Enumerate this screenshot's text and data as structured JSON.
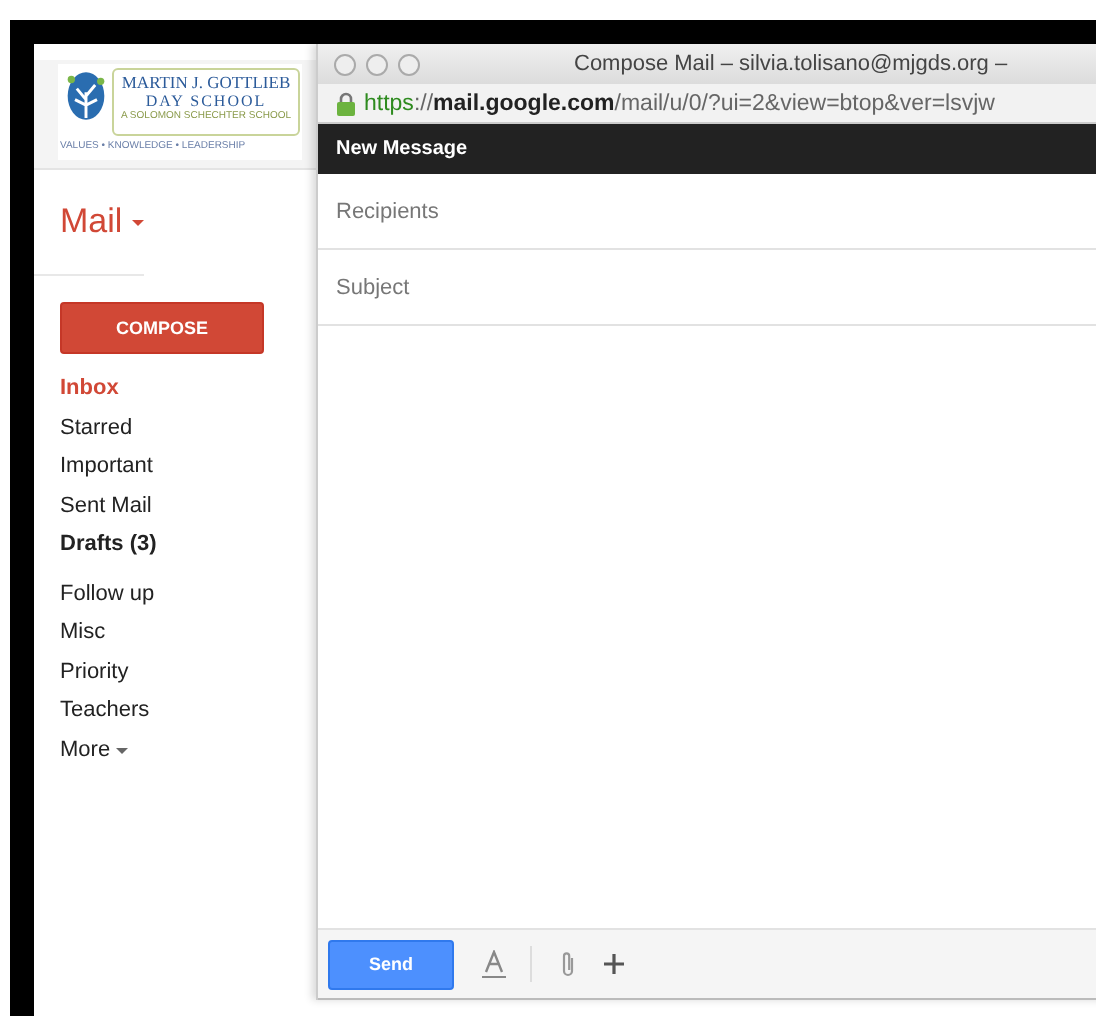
{
  "logo": {
    "name_line_1": "MARTIN J. GOTTLIEB",
    "name_line_2": "DAY SCHOOL",
    "subtitle": "A SOLOMON SCHECHTER SCHOOL",
    "motto": "VALUES • KNOWLEDGE • LEADERSHIP"
  },
  "app_menu": {
    "label": "Mail"
  },
  "compose_button": {
    "label": "COMPOSE"
  },
  "folders": [
    {
      "label": "Inbox",
      "selected": true,
      "unread": false
    },
    {
      "label": "Starred",
      "selected": false,
      "unread": false
    },
    {
      "label": "Important",
      "selected": false,
      "unread": false
    },
    {
      "label": "Sent Mail",
      "selected": false,
      "unread": false
    },
    {
      "label": "Drafts (3)",
      "selected": false,
      "unread": true
    }
  ],
  "labels": [
    {
      "label": "Follow up",
      "selected": false,
      "unread": false
    },
    {
      "label": "Misc",
      "selected": false,
      "unread": false
    },
    {
      "label": "Priority",
      "selected": false,
      "unread": false
    },
    {
      "label": "Teachers",
      "selected": false,
      "unread": false
    }
  ],
  "more": {
    "label": "More"
  },
  "popup": {
    "title": "Compose Mail – silvia.tolisano@mjgds.org –",
    "url": {
      "scheme": "https",
      "separator": "://",
      "host": "mail.google.com",
      "path": "/mail/u/0/?ui=2&view=btop&ver=lsvjw"
    },
    "header": "New Message",
    "recipients": {
      "placeholder": "Recipients"
    },
    "subject": {
      "placeholder": "Subject"
    },
    "send_button": {
      "label": "Send"
    }
  }
}
